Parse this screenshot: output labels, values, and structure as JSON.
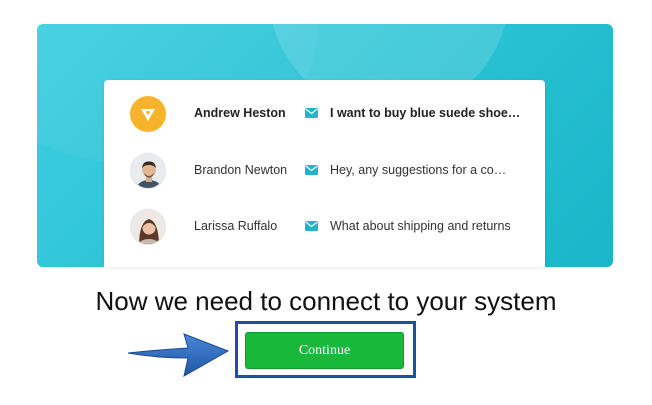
{
  "conversations": [
    {
      "name": "Andrew Heston",
      "message": "I want to buy blue suede shoe…",
      "unread": true,
      "avatar": "company-logo-icon"
    },
    {
      "name": "Brandon Newton",
      "message": "Hey, any suggestions for a co…",
      "unread": false,
      "avatar": "user-avatar-brandon"
    },
    {
      "name": "Larissa Ruffalo",
      "message": "What about shipping and returns",
      "unread": false,
      "avatar": "user-avatar-larissa"
    }
  ],
  "headline": "Now we need to connect to your system",
  "continue_button": {
    "label": "Continue"
  },
  "colors": {
    "hero_teal": "#2cc4d6",
    "logo_yellow": "#f7b32b",
    "mail_icon": "#1fb7c9",
    "button_green": "#18b83a",
    "highlight_blue": "#1f4fa3"
  }
}
